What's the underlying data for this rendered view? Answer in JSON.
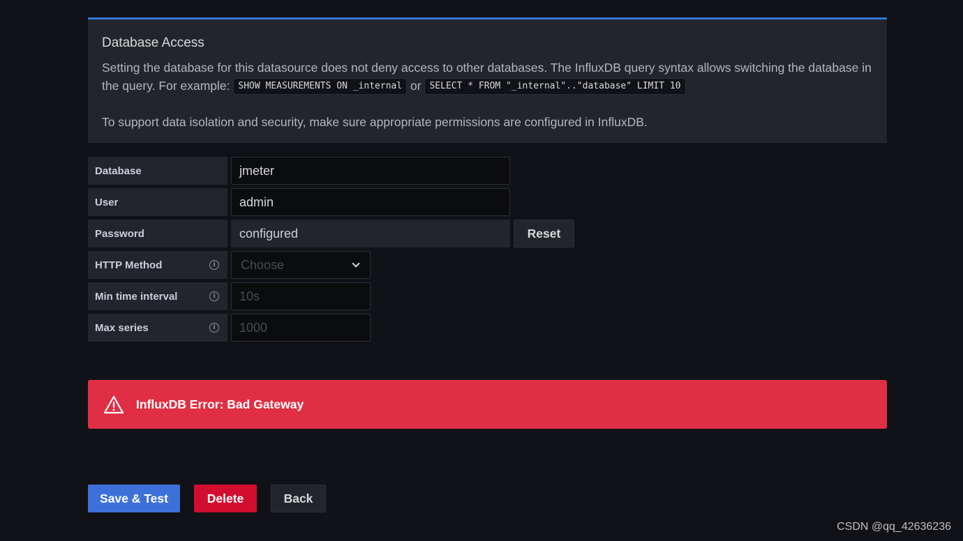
{
  "info_box": {
    "title": "Database Access",
    "text_part1": "Setting the database for this datasource does not deny access to other databases. The InfluxDB query syntax allows switching the database in the query. For example: ",
    "code1": "SHOW MEASUREMENTS ON _internal",
    "text_or": " or ",
    "code2": "SELECT * FROM \"_internal\"..\"database\" LIMIT 10",
    "text_security": "To support data isolation and security, make sure appropriate permissions are configured in InfluxDB."
  },
  "form": {
    "database": {
      "label": "Database",
      "value": "jmeter"
    },
    "user": {
      "label": "User",
      "value": "admin"
    },
    "password": {
      "label": "Password",
      "value": "configured",
      "reset_label": "Reset"
    },
    "http_method": {
      "label": "HTTP Method",
      "placeholder": "Choose"
    },
    "min_time_interval": {
      "label": "Min time interval",
      "placeholder": "10s"
    },
    "max_series": {
      "label": "Max series",
      "placeholder": "1000"
    }
  },
  "alert": {
    "message": "InfluxDB Error: Bad Gateway",
    "icon": "warning-triangle-icon",
    "color": "#e02f44"
  },
  "actions": {
    "save_label": "Save & Test",
    "delete_label": "Delete",
    "back_label": "Back"
  },
  "watermark": "CSDN @qq_42636236",
  "colors": {
    "accent": "#3274d9",
    "danger": "#d10e2f",
    "background": "#111217"
  }
}
